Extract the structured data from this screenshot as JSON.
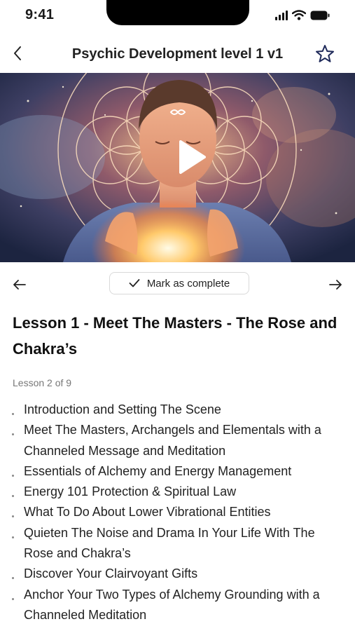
{
  "status_bar": {
    "time": "9:41"
  },
  "header": {
    "title": "Psychic Development level 1 v1"
  },
  "nav": {
    "complete_label": "Mark as complete"
  },
  "lesson": {
    "title": "Lesson 1 - Meet The Masters - The Rose and Chakra’s",
    "counter": "Lesson 2 of 9"
  },
  "outline": [
    "Introduction and Setting The Scene",
    "Meet The Masters, Archangels and Elementals with a Channeled Message and Meditation",
    "Essentials of Alchemy and Energy Management",
    "Energy 101 Protection & Spiritual Law",
    "What To Do About Lower Vibrational Entities",
    "Quieten The Noise and Drama In Your Life With The Rose and Chakra’s",
    "Discover Your Clairvoyant Gifts",
    "Anchor Your Two Types of Alchemy Grounding with a Channeled Meditation"
  ],
  "colors": {
    "accent": "#1f2a5a",
    "text": "#1b1b1b",
    "muted": "#777777",
    "border": "#d9d9d9"
  },
  "icons": {
    "back": "chevron-left",
    "favorite": "star-outline",
    "play": "play",
    "prev": "arrow-left",
    "next": "arrow-right",
    "check": "checkmark"
  }
}
